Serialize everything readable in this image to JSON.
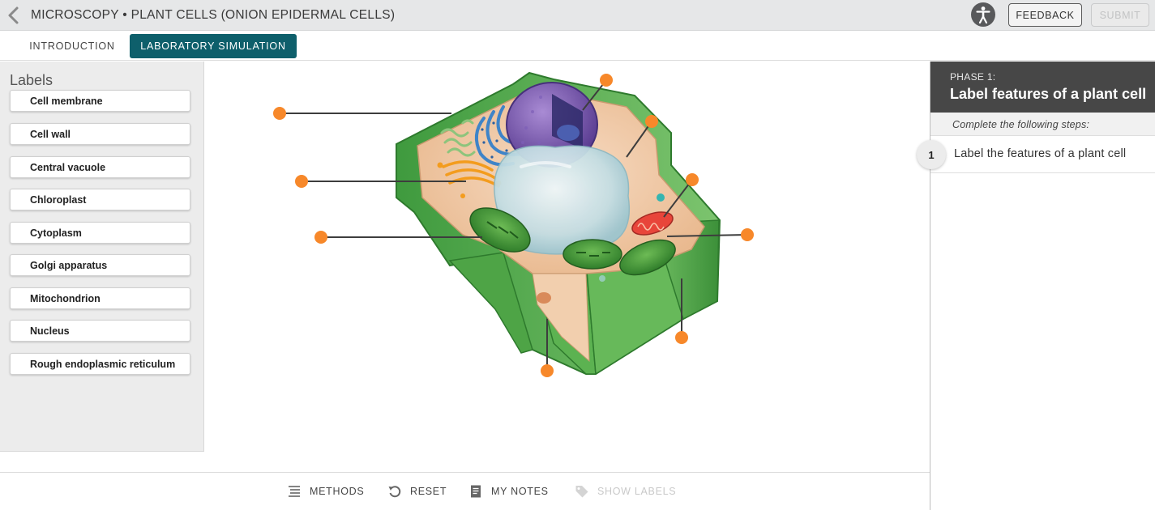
{
  "header": {
    "title": "MICROSCOPY • PLANT CELLS (ONION EPIDERMAL CELLS)",
    "feedback_label": "FEEDBACK",
    "submit_label": "SUBMIT"
  },
  "tabs": [
    {
      "label": "INTRODUCTION",
      "active": false
    },
    {
      "label": "LABORATORY SIMULATION",
      "active": true
    }
  ],
  "labels_panel": {
    "title": "Labels",
    "items": [
      "Cell membrane",
      "Cell wall",
      "Central vacuole",
      "Chloroplast",
      "Cytoplasm",
      "Golgi apparatus",
      "Mitochondrion",
      "Nucleus",
      "Rough endoplasmic reticulum"
    ]
  },
  "diagram": {
    "icons": [
      "plant-cell-illustration",
      "label-marker-dot"
    ],
    "marker_color": "#f7882a",
    "marker_count": 9
  },
  "phase": {
    "label": "PHASE 1:",
    "title": "Label features of a plant cell",
    "steps_heading": "Complete the following steps:",
    "steps": [
      {
        "number": "1",
        "text": "Label the features of a plant cell"
      }
    ]
  },
  "toolbar": {
    "methods_label": "METHODS",
    "reset_label": "RESET",
    "notes_label": "MY NOTES",
    "show_labels_label": "SHOW LABELS"
  },
  "colors": {
    "accent": "#0e5f6b",
    "phase_bg": "#474747",
    "marker": "#f7882a"
  }
}
